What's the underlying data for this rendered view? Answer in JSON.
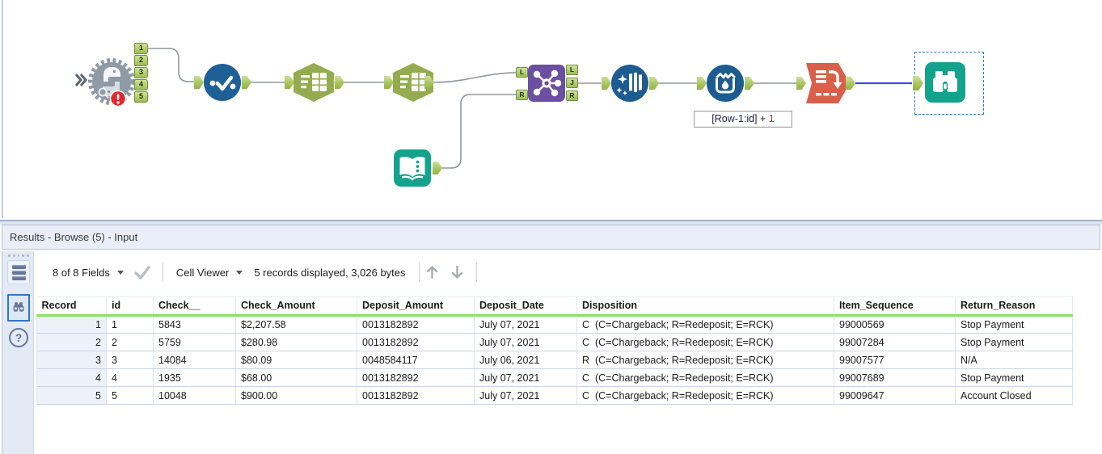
{
  "colors": {
    "anchor_green": "#a9c55f",
    "select_blue": "#1e5f96",
    "parse_green": "#94ac4f",
    "join_purple": "#6b4fa0",
    "formula_blue": "#1d5c90",
    "transform_orange": "#d95f4b",
    "browse_teal": "#13a28b",
    "error_red": "#e8262c",
    "selected_connection_blue": "#3f4ae0",
    "header_underline_green": "#8ce063"
  },
  "canvas": {
    "python_tool": {
      "outputs": [
        "1",
        "2",
        "3",
        "4",
        "5"
      ]
    },
    "join_tool": {
      "inputs": [
        "L",
        "R"
      ],
      "outputs": [
        "L",
        "J",
        "R"
      ]
    },
    "annotation": {
      "prefix": "[Row-1:id] + ",
      "value": "1"
    }
  },
  "results": {
    "title": "Results - Browse (5) - Input",
    "toolbar": {
      "fields_dropdown": "8 of 8 Fields",
      "cell_viewer_dropdown": "Cell Viewer",
      "records_info": "5 records displayed, 3,026 bytes"
    },
    "table": {
      "columns": [
        "Record",
        "id",
        "Check__",
        "Check_Amount",
        "Deposit_Amount",
        "Deposit_Date",
        "Disposition",
        "Item_Sequence",
        "Return_Reason"
      ],
      "rows": [
        [
          "1",
          "1",
          "5843",
          "$2,207.58",
          "0013182892",
          "July 07, 2021",
          "C  (C=Chargeback; R=Redeposit; E=RCK)",
          "99000569",
          "Stop Payment"
        ],
        [
          "2",
          "2",
          "5759",
          "$280.98",
          "0013182892",
          "July 07, 2021",
          "C  (C=Chargeback; R=Redeposit; E=RCK)",
          "99007284",
          "Stop Payment"
        ],
        [
          "3",
          "3",
          "14084",
          "$80.09",
          "0048584117",
          "July 06, 2021",
          "R  (C=Chargeback; R=Redeposit; E=RCK)",
          "99007577",
          "N/A"
        ],
        [
          "4",
          "4",
          "1935",
          "$68.00",
          "0013182892",
          "July 07, 2021",
          "C  (C=Chargeback; R=Redeposit; E=RCK)",
          "99007689",
          "Stop Payment"
        ],
        [
          "5",
          "5",
          "10048",
          "$900.00",
          "0013182892",
          "July 07, 2021",
          "C  (C=Chargeback; R=Redeposit; E=RCK)",
          "99009647",
          "Account Closed"
        ]
      ]
    }
  }
}
